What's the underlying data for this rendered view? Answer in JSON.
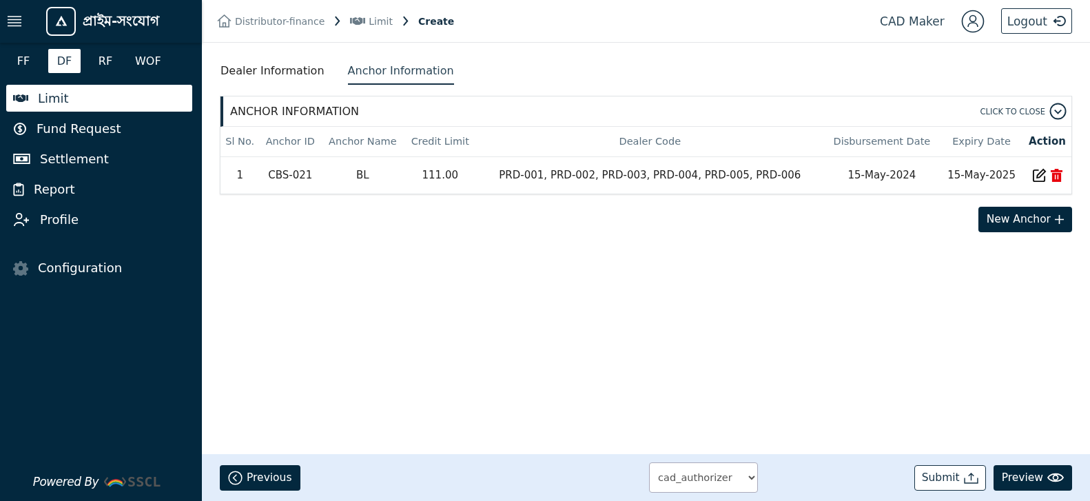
{
  "sidebar": {
    "brand": "প্রাইম-সংযোগ",
    "modules": [
      {
        "label": "FF",
        "selected": false
      },
      {
        "label": "DF",
        "selected": true
      },
      {
        "label": "RF",
        "selected": false
      },
      {
        "label": "WOF",
        "selected": false
      }
    ],
    "items": [
      {
        "label": "Limit",
        "kind": "handshake",
        "selected": true
      },
      {
        "label": "Fund Request",
        "kind": "dollar",
        "selected": false
      },
      {
        "label": "Settlement",
        "kind": "cash",
        "selected": false
      },
      {
        "label": "Report",
        "kind": "clipboard",
        "selected": false
      },
      {
        "label": "Profile",
        "kind": "person",
        "selected": false
      },
      {
        "label": "Configuration",
        "kind": "gear",
        "selected": false
      }
    ],
    "powered_by": "Powered By",
    "powered_logo": "SSCL"
  },
  "breadcrumb": [
    {
      "label": "Distributor-finance",
      "kind": "home"
    },
    {
      "label": "Limit",
      "kind": "handshake"
    },
    {
      "label": "Create",
      "kind": "current"
    }
  ],
  "user": {
    "name": "CAD Maker",
    "logout": "Logout"
  },
  "tabs": [
    {
      "label": "Dealer Information",
      "selected": false
    },
    {
      "label": "Anchor Information",
      "selected": true
    }
  ],
  "panel": {
    "title": "ANCHOR INFORMATION",
    "toggle": "CLICK TO CLOSE"
  },
  "table": {
    "columns": [
      "Sl No.",
      "Anchor ID",
      "Anchor Name",
      "Credit Limit",
      "Dealer Code",
      "Disbursement Date",
      "Expiry Date",
      "Action"
    ],
    "rows": [
      [
        "1",
        "CBS-021",
        "BL",
        "111.00",
        "PRD-001, PRD-002, PRD-003, PRD-004, PRD-005, PRD-006",
        "15-May-2024",
        "15-May-2025"
      ]
    ]
  },
  "new_button": "New Anchor",
  "footer": {
    "previous": "Previous",
    "select_value": "cad_authorizer",
    "submit": "Submit",
    "preview": "Preview"
  }
}
